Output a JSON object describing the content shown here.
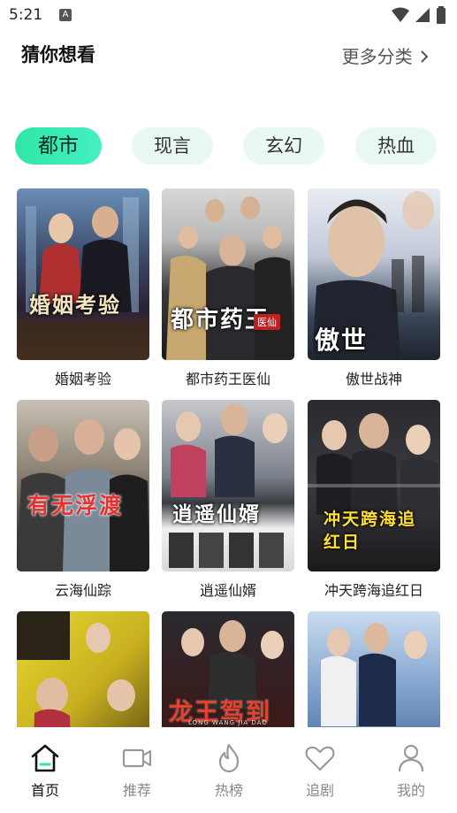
{
  "status_bar": {
    "time": "5:21",
    "notif_letter": "A"
  },
  "header": {
    "title": "猜你想看",
    "more_label": "更多分类"
  },
  "tabs": [
    {
      "label": "都市",
      "active": true
    },
    {
      "label": "现言",
      "active": false
    },
    {
      "label": "玄幻",
      "active": false
    },
    {
      "label": "热血",
      "active": false
    }
  ],
  "dramas": [
    {
      "caption": "婚姻考验",
      "poster_text": "婚姻考验"
    },
    {
      "caption": "都市药王医仙",
      "poster_text": "都市药王"
    },
    {
      "caption": "傲世战神",
      "poster_text": "傲世"
    },
    {
      "caption": "云海仙踪",
      "poster_text": "有无浮渡"
    },
    {
      "caption": "逍遥仙婿",
      "poster_text": "逍遥仙婿"
    },
    {
      "caption": "冲天跨海追红日",
      "poster_text": "冲天跨海追红日"
    },
    {
      "caption": "",
      "poster_text": ""
    },
    {
      "caption": "",
      "poster_text": "龙王驾到"
    },
    {
      "caption": "",
      "poster_text": ""
    }
  ],
  "poster_badges": {
    "yixian": "医仙",
    "longwang_sub": "LONG WANG JIA DAO"
  },
  "bottom_nav": [
    {
      "label": "首页",
      "icon": "home-icon",
      "active": true
    },
    {
      "label": "推荐",
      "icon": "video-camera-icon",
      "active": false
    },
    {
      "label": "热榜",
      "icon": "flame-icon",
      "active": false
    },
    {
      "label": "追剧",
      "icon": "heart-icon",
      "active": false
    },
    {
      "label": "我的",
      "icon": "person-icon",
      "active": false
    }
  ],
  "colors": {
    "accent": "#2fe6a8",
    "tab_bg": "#e9f9f1",
    "nav_inactive": "#888888"
  }
}
